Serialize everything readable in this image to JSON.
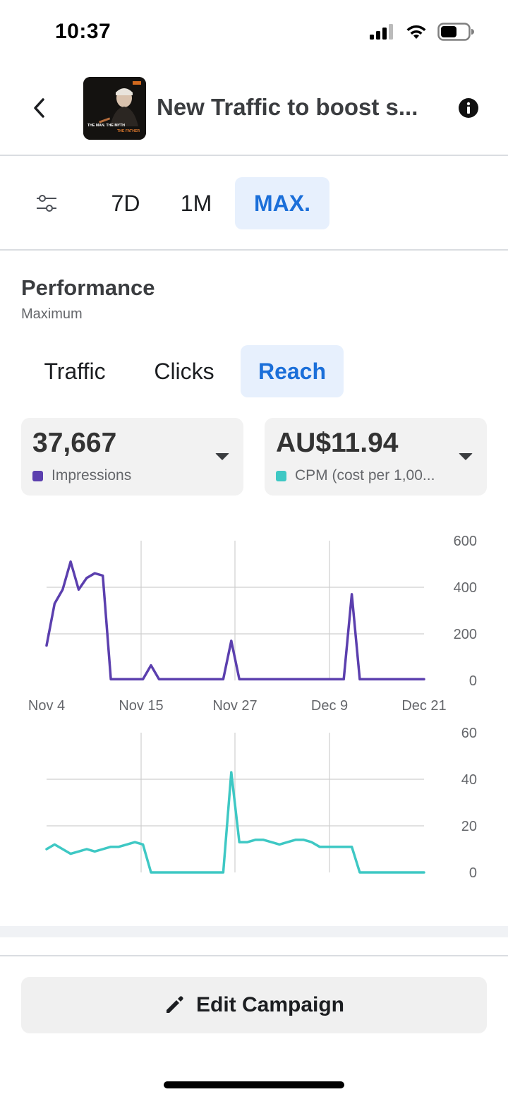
{
  "status": {
    "time": "10:37"
  },
  "header": {
    "title": "New Traffic to boost s...",
    "thumbnail_text_1": "THE MAN. THE MYTH",
    "thumbnail_text_2": "THE FATHER"
  },
  "range_tabs": [
    {
      "label": "7D",
      "active": false
    },
    {
      "label": "1M",
      "active": false
    },
    {
      "label": "MAX.",
      "active": true
    }
  ],
  "performance": {
    "title": "Performance",
    "subtitle": "Maximum"
  },
  "metric_tabs": [
    {
      "label": "Traffic",
      "active": false
    },
    {
      "label": "Clicks",
      "active": false
    },
    {
      "label": "Reach",
      "active": true
    }
  ],
  "stats": [
    {
      "value": "37,667",
      "label": "Impressions",
      "color": "#5b3fae"
    },
    {
      "value": "AU$11.94",
      "label": "CPM (cost per 1,00...",
      "color": "#3ec8c4"
    }
  ],
  "chart_data": [
    {
      "type": "line",
      "series": [
        {
          "name": "Impressions",
          "color": "#5b3fae"
        }
      ],
      "x": [
        0,
        1,
        2,
        3,
        4,
        5,
        6,
        7,
        8,
        9,
        10,
        11,
        12,
        13,
        14,
        15,
        16,
        17,
        18,
        19,
        20,
        21,
        22,
        23,
        24,
        25,
        26,
        27,
        28,
        29,
        30,
        31,
        32,
        33,
        34,
        35,
        36,
        37,
        38,
        39,
        40,
        41,
        42,
        43,
        44,
        45,
        46,
        47
      ],
      "values": [
        150,
        330,
        390,
        510,
        390,
        440,
        460,
        450,
        5,
        5,
        5,
        5,
        5,
        65,
        5,
        5,
        5,
        5,
        5,
        5,
        5,
        5,
        5,
        170,
        5,
        5,
        5,
        5,
        5,
        5,
        5,
        5,
        5,
        5,
        5,
        5,
        5,
        5,
        370,
        5,
        5,
        5,
        5,
        5,
        5,
        5,
        5,
        5
      ],
      "xticks": [
        "Nov 4",
        "Nov 15",
        "Nov 27",
        "Dec 9",
        "Dec 21"
      ],
      "yticks": [
        "600",
        "400",
        "200",
        "0"
      ],
      "ylim": [
        0,
        600
      ],
      "grid": true
    },
    {
      "type": "line",
      "series": [
        {
          "name": "CPM (cost per 1,00...",
          "color": "#3ec8c4"
        }
      ],
      "x": [
        0,
        1,
        2,
        3,
        4,
        5,
        6,
        7,
        8,
        9,
        10,
        11,
        12,
        13,
        14,
        15,
        16,
        17,
        18,
        19,
        20,
        21,
        22,
        23,
        24,
        25,
        26,
        27,
        28,
        29,
        30,
        31,
        32,
        33,
        34,
        35,
        36,
        37,
        38,
        39,
        40,
        41,
        42,
        43,
        44,
        45,
        46,
        47
      ],
      "values": [
        10,
        12,
        10,
        8,
        9,
        10,
        9,
        10,
        11,
        11,
        12,
        13,
        12,
        0,
        0,
        0,
        0,
        0,
        0,
        0,
        0,
        0,
        0,
        43,
        13,
        13,
        14,
        14,
        13,
        12,
        13,
        14,
        14,
        13,
        11,
        11,
        11,
        11,
        11,
        0,
        0,
        0,
        0,
        0,
        0,
        0,
        0,
        0
      ],
      "yticks": [
        "60",
        "40",
        "20",
        "0"
      ],
      "ylim": [
        0,
        60
      ],
      "grid": true
    }
  ],
  "footer": {
    "edit_label": "Edit Campaign"
  }
}
